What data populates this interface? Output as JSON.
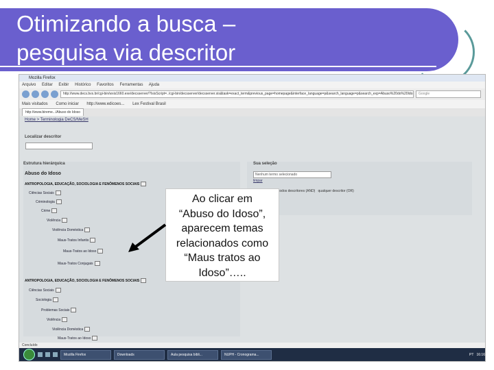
{
  "slide": {
    "title_line1": "Otimizando a busca –",
    "title_line2": "pesquisa via descritor",
    "accent": "#6a5fce"
  },
  "browser": {
    "window_title": "Mozilla Firefox",
    "menu": [
      "Arquivo",
      "Editar",
      "Exibir",
      "Histórico",
      "Favoritos",
      "Ferramentas",
      "Ajuda"
    ],
    "url": "http://www.decs.bvs.br/cgi-bin/wxis1660.exe/decsserver/?IsisScript=../cgi-bin/decsserver/decsserver.xis&task=exact_term&previous_page=homepage&interface_language=p&search_language=p&search_exp=Abuso%20do%20Idoso",
    "search_placeholder": "Google",
    "bookmarks": [
      "Mais visitados",
      "Como iniciar",
      "http://www.edicoes...",
      "Lex Festival Brasil"
    ],
    "tab": "http://www.bireme.../Abuso do Idoso",
    "status": "Concluído"
  },
  "page": {
    "breadcrumb": "Home > Terminologia DeCS/MeSH",
    "localizar_label": "Localizar descritor",
    "estrutura_label": "Estrutura hierárquica",
    "selected_term": "Abuso do Idoso",
    "tree1": [
      {
        "text": "ANTROPOLOGIA, EDUCAÇÃO, SOCIOLOGIA E FENÔMENOS SOCIAIS"
      },
      {
        "text": "Ciências Sociais"
      },
      {
        "text": "Criminologia"
      },
      {
        "text": "Crime"
      },
      {
        "text": "Violência"
      },
      {
        "text": "Violência Doméstica"
      },
      {
        "text": "Maus-Tratos Infantis"
      },
      {
        "text": "Maus-Tratos ao Idoso"
      },
      {
        "text": "Maus-Tratos Conjugais"
      }
    ],
    "tree2": [
      {
        "text": "ANTROPOLOGIA, EDUCAÇÃO, SOCIOLOGIA E FENÔMENOS SOCIAIS"
      },
      {
        "text": "Ciências Sociais"
      },
      {
        "text": "Sociologia"
      },
      {
        "text": "Problemas Sociais"
      },
      {
        "text": "Violência"
      },
      {
        "text": "Violência Doméstica"
      },
      {
        "text": "Maus-Tratos ao Idoso"
      }
    ],
    "sua_selecao_label": "Sua seleção",
    "selection_placeholder": "Nenhum termo selecionado",
    "limpar": "limpar",
    "radio_and": "todos descritores (AND)",
    "radio_or": "qualquer descritor (OR)"
  },
  "taskbar": {
    "items": [
      "Mozilla Firefox",
      "Downloads",
      "Aula pesquisa bibli...",
      "NUPH - Cronograma..."
    ],
    "lang": "PT",
    "clock": "16:16"
  },
  "callout": {
    "line1": "Ao clicar em",
    "line2": "“Abuso do Idoso”,",
    "line3": "aparecem temas",
    "line4": "relacionados como",
    "line5": "“Maus tratos ao",
    "line6": "Idoso”….."
  }
}
